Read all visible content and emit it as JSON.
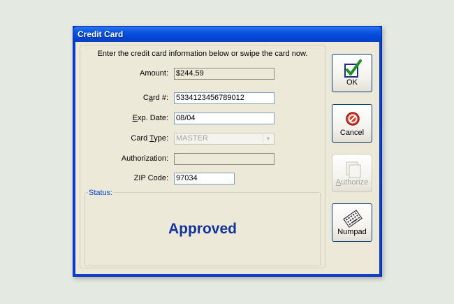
{
  "window": {
    "title": "Credit Card"
  },
  "form": {
    "instruction": "Enter the credit card information below or swipe the card now.",
    "amount": {
      "label": "Amount:",
      "value": "$244.59"
    },
    "card_number": {
      "label_pre": "C",
      "label_key": "a",
      "label_post": "rd #:",
      "value": "5334123456789012"
    },
    "exp_date": {
      "label_key": "E",
      "label_post": "xp. Date:",
      "value": "08/04"
    },
    "card_type": {
      "label_pre": "Card ",
      "label_key": "T",
      "label_post": "ype:",
      "value": "MASTER"
    },
    "authorization": {
      "label": "Authorization:",
      "value": ""
    },
    "zip": {
      "label": "ZIP Code:",
      "value": "97034"
    }
  },
  "status": {
    "label": "Status:",
    "value": "Approved"
  },
  "buttons": {
    "ok": "OK",
    "cancel": "Cancel",
    "authorize_key": "A",
    "authorize_post": "uthorize",
    "numpad": "Numpad"
  },
  "icons": {
    "ok": "checkmark-icon",
    "cancel": "no-entry-icon",
    "authorize": "card-stack-icon",
    "numpad": "keypad-icon"
  },
  "colors": {
    "title_bar": "#0a46d6",
    "status_text": "#12349c",
    "status_label": "#0046d5"
  }
}
